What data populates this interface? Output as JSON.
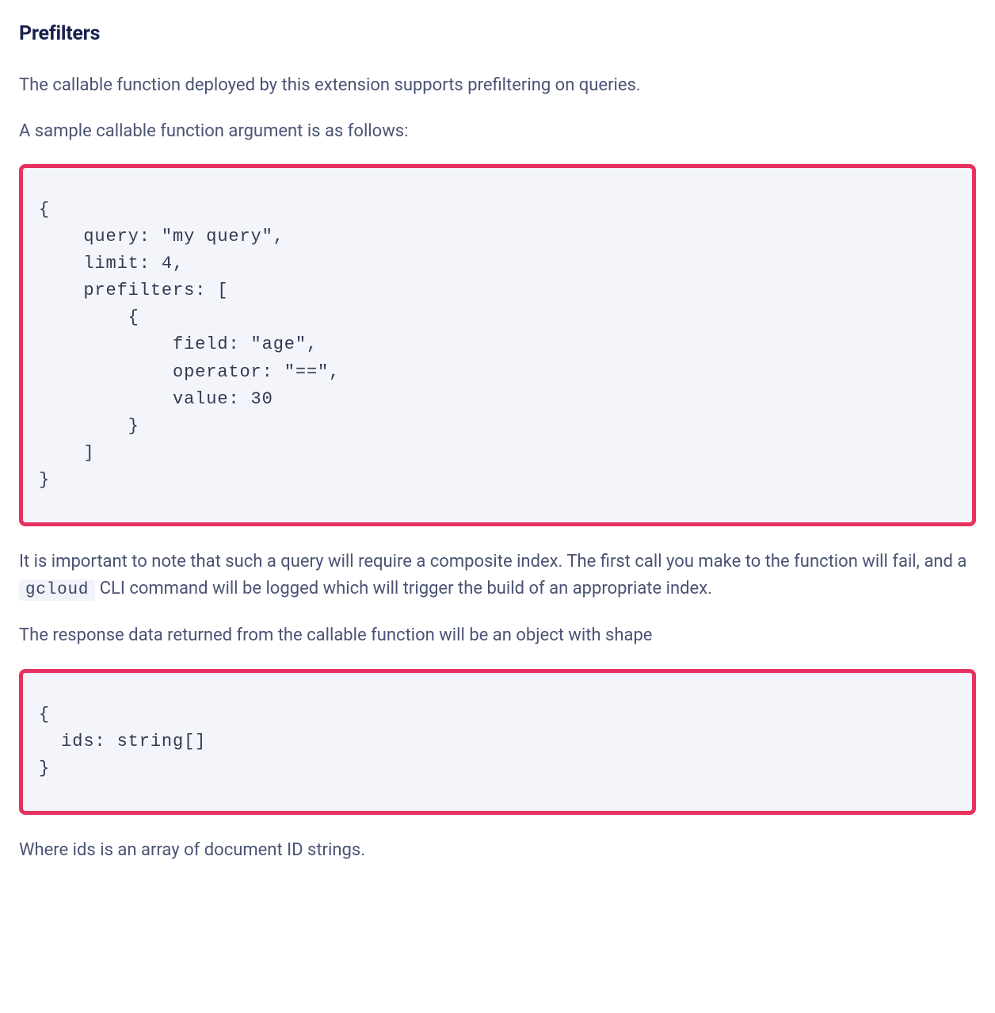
{
  "heading": "Prefilters",
  "intro_paragraph": "The callable function deployed by this extension supports prefiltering on queries.",
  "sample_lead_in": "A sample callable function argument is as follows:",
  "code_block_1": "{\n    query: \"my query\",\n    limit: 4,\n    prefilters: [\n        {\n            field: \"age\",\n            operator: \"==\",\n            value: 30\n        }\n    ]\n}",
  "composite_note_pre": "It is important to note that such a query will require a composite index. The first call you make to the function will fail, and a ",
  "composite_note_code": "gcloud",
  "composite_note_post": " CLI command will be logged which will trigger the build of an appropriate index.",
  "response_lead_in": "The response data returned from the callable function will be an object with shape",
  "code_block_2": "{\n  ids: string[]\n}",
  "closing": "Where ids is an array of document ID strings."
}
